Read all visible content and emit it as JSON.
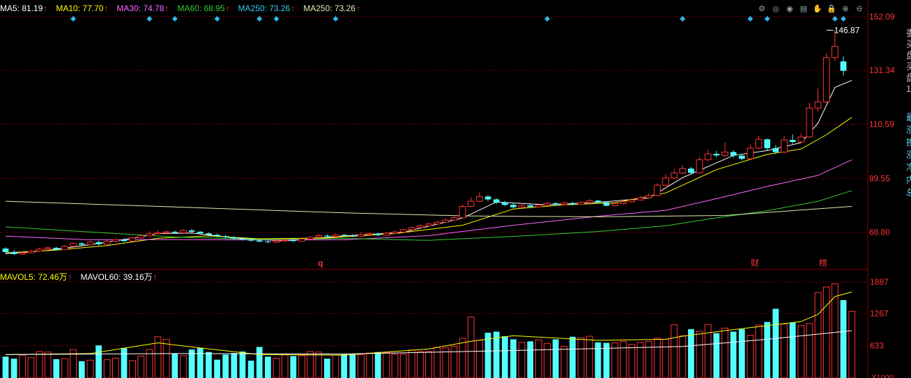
{
  "legend_main": [
    {
      "label": "MA5: 81.19",
      "color": "#ffffff"
    },
    {
      "label": "MA10: 77.70",
      "color": "#ffff00"
    },
    {
      "label": "MA30: 74.78",
      "color": "#ff66ff"
    },
    {
      "label": "MA60: 68.95",
      "color": "#33cc33"
    },
    {
      "label": "MA250: 73.26",
      "color": "#33ccee"
    },
    {
      "label": "MA250: 73.26",
      "color": "#e8e8b0"
    }
  ],
  "legend_volume": [
    {
      "label": "MAVOL5: 72.46万",
      "color": "#ffff00"
    },
    {
      "label": "MAVOL60: 39.16万",
      "color": "#ffffff"
    }
  ],
  "toolbar_icons": [
    "settings-icon",
    "eye-icon",
    "eye-open-icon",
    "calendar-icon",
    "hand-icon",
    "lock-icon",
    "zoom-in-icon",
    "zoom-out-icon"
  ],
  "price_axis_labels": [
    "152.09",
    "131.34",
    "110.59",
    "89.55",
    "68.80"
  ],
  "volume_axis_labels": [
    "1887",
    "1267",
    "633",
    "X1000"
  ],
  "high_label": "146.87",
  "markers": {
    "q": "q",
    "cai": "财",
    "bang": "榜"
  },
  "side_labels": {
    "text": [
      "委",
      "买",
      "盘",
      "买",
      "盘",
      "1"
    ],
    "blue": [
      "最",
      "涨",
      "换",
      "涨",
      "净",
      "内",
      "总"
    ]
  },
  "colors": {
    "up": "#ff3333",
    "down": "#54ffff",
    "grid": "#8b0000",
    "axis_text": "#ff3333",
    "diamond": "#2fb6e9"
  },
  "chart_data": [
    {
      "type": "candlestick",
      "y_axis": {
        "min": 55.0,
        "max": 152.09,
        "ticks": [
          152.09,
          131.34,
          110.59,
          89.55,
          68.8
        ]
      },
      "x_index_range": [
        0,
        100
      ],
      "high_marker": {
        "index": 97,
        "value": 146.87
      },
      "candles": [
        [
          62.5,
          61.2,
          63.0,
          60.8
        ],
        [
          61.2,
          60.4,
          61.9,
          60.0
        ],
        [
          60.4,
          60.9,
          61.4,
          60.1
        ],
        [
          60.9,
          61.5,
          62.0,
          60.6
        ],
        [
          61.5,
          62.3,
          62.9,
          61.2
        ],
        [
          62.3,
          62.8,
          63.3,
          62.0
        ],
        [
          62.8,
          62.1,
          63.2,
          61.7
        ],
        [
          62.1,
          63.4,
          63.8,
          61.9
        ],
        [
          63.4,
          64.5,
          65.0,
          63.1
        ],
        [
          64.5,
          64.0,
          64.9,
          63.6
        ],
        [
          64.0,
          65.0,
          65.5,
          63.8
        ],
        [
          65.0,
          64.2,
          65.5,
          63.7
        ],
        [
          64.2,
          65.3,
          65.8,
          63.9
        ],
        [
          65.3,
          66.0,
          66.4,
          64.9
        ],
        [
          66.0,
          65.4,
          66.5,
          65.0
        ],
        [
          65.4,
          66.6,
          67.0,
          65.2
        ],
        [
          66.6,
          67.4,
          68.0,
          66.3
        ],
        [
          67.4,
          68.2,
          69.2,
          67.1
        ],
        [
          68.2,
          68.6,
          69.6,
          68.0
        ],
        [
          68.6,
          69.0,
          69.5,
          68.3
        ],
        [
          69.0,
          68.6,
          69.4,
          68.1
        ],
        [
          68.6,
          69.5,
          70.0,
          68.4
        ],
        [
          69.5,
          69.0,
          70.1,
          68.6
        ],
        [
          69.0,
          68.4,
          69.3,
          68.0
        ],
        [
          68.4,
          67.8,
          68.7,
          67.3
        ],
        [
          67.8,
          67.3,
          68.2,
          66.9
        ],
        [
          67.3,
          66.9,
          67.7,
          66.5
        ],
        [
          66.9,
          66.4,
          67.3,
          66.0
        ],
        [
          66.4,
          66.0,
          66.9,
          65.6
        ],
        [
          66.0,
          65.6,
          66.4,
          65.2
        ],
        [
          65.6,
          65.2,
          66.0,
          64.9
        ],
        [
          65.2,
          65.0,
          65.6,
          64.6
        ],
        [
          65.0,
          65.5,
          65.9,
          64.7
        ],
        [
          65.5,
          65.8,
          66.2,
          65.2
        ],
        [
          65.8,
          65.4,
          66.3,
          65.0
        ],
        [
          65.4,
          66.2,
          66.7,
          65.1
        ],
        [
          66.2,
          66.9,
          67.4,
          65.9
        ],
        [
          66.9,
          67.5,
          68.2,
          66.6
        ],
        [
          67.5,
          67.2,
          68.0,
          66.8
        ],
        [
          67.2,
          67.8,
          68.3,
          66.9
        ],
        [
          67.8,
          67.6,
          68.2,
          67.3
        ],
        [
          67.6,
          67.3,
          68.0,
          67.0
        ],
        [
          67.3,
          67.9,
          68.9,
          67.1
        ],
        [
          67.9,
          68.3,
          68.8,
          67.6
        ],
        [
          68.3,
          67.7,
          68.6,
          67.3
        ],
        [
          67.7,
          68.4,
          68.9,
          67.4
        ],
        [
          68.4,
          68.9,
          69.4,
          68.1
        ],
        [
          68.9,
          69.8,
          70.3,
          68.7
        ],
        [
          69.8,
          70.6,
          71.2,
          69.5
        ],
        [
          70.6,
          71.3,
          71.9,
          70.3
        ],
        [
          71.3,
          72.0,
          72.6,
          71.0
        ],
        [
          72.0,
          72.7,
          73.3,
          71.7
        ],
        [
          72.7,
          73.5,
          74.2,
          72.4
        ],
        [
          73.5,
          74.4,
          75.1,
          73.2
        ],
        [
          74.4,
          78.8,
          79.5,
          74.1
        ],
        [
          78.8,
          80.8,
          82.4,
          78.5
        ],
        [
          80.8,
          82.6,
          84.3,
          80.4
        ],
        [
          82.6,
          81.5,
          83.1,
          80.9
        ],
        [
          81.5,
          80.3,
          82.0,
          79.8
        ],
        [
          80.3,
          79.4,
          80.9,
          78.9
        ],
        [
          79.4,
          78.5,
          79.9,
          78.0
        ],
        [
          78.5,
          79.2,
          79.8,
          78.1
        ],
        [
          79.2,
          78.6,
          79.7,
          78.2
        ],
        [
          78.6,
          79.3,
          79.9,
          78.3
        ],
        [
          79.3,
          80.0,
          80.6,
          79.0
        ],
        [
          80.0,
          79.5,
          80.5,
          79.1
        ],
        [
          79.5,
          80.1,
          80.7,
          79.2
        ],
        [
          80.1,
          79.6,
          80.5,
          79.2
        ],
        [
          79.6,
          80.3,
          80.9,
          79.3
        ],
        [
          80.3,
          81.0,
          81.6,
          80.0
        ],
        [
          81.0,
          80.4,
          81.4,
          80.0
        ],
        [
          80.4,
          79.1,
          80.7,
          78.7
        ],
        [
          79.1,
          79.9,
          80.5,
          78.8
        ],
        [
          79.9,
          80.6,
          81.2,
          79.6
        ],
        [
          80.6,
          81.3,
          81.9,
          80.3
        ],
        [
          81.3,
          82.1,
          82.9,
          81.0
        ],
        [
          82.1,
          83.0,
          83.9,
          81.8
        ],
        [
          83.0,
          87.0,
          87.7,
          82.7
        ],
        [
          87.0,
          89.8,
          91.3,
          86.6
        ],
        [
          89.8,
          91.7,
          93.3,
          89.4
        ],
        [
          91.7,
          93.4,
          94.8,
          91.3
        ],
        [
          93.4,
          91.8,
          94.0,
          91.0
        ],
        [
          91.8,
          96.8,
          98.0,
          91.5
        ],
        [
          96.8,
          99.1,
          100.7,
          96.3
        ],
        [
          99.1,
          98.5,
          100.2,
          97.8
        ],
        [
          98.5,
          99.8,
          103.5,
          97.9
        ],
        [
          99.8,
          98.4,
          100.5,
          97.6
        ],
        [
          98.4,
          97.2,
          99.0,
          96.6
        ],
        [
          97.2,
          101.3,
          102.7,
          96.9
        ],
        [
          101.3,
          104.7,
          106.1,
          100.8
        ],
        [
          104.7,
          101.3,
          105.0,
          100.3
        ],
        [
          101.3,
          99.8,
          102.5,
          99.0
        ],
        [
          99.8,
          104.5,
          105.9,
          99.3
        ],
        [
          104.5,
          103.7,
          106.6,
          103.0
        ],
        [
          103.7,
          105.6,
          107.2,
          103.2
        ],
        [
          105.6,
          116.8,
          118.9,
          105.3
        ],
        [
          116.8,
          119.2,
          124.3,
          115.5
        ],
        [
          119.2,
          136.3,
          138.0,
          118.7
        ],
        [
          136.3,
          140.6,
          146.87,
          135.0
        ],
        [
          134.8,
          131.2,
          136.8,
          129.4
        ]
      ],
      "ma_lines": [
        {
          "name": "MA5",
          "color": "#ffffff",
          "points": [
            [
              0,
              60.5
            ],
            [
              5,
              61.8
            ],
            [
              10,
              64.0
            ],
            [
              15,
              66.5
            ],
            [
              18,
              68.3
            ],
            [
              22,
              68.5
            ],
            [
              27,
              66.6
            ],
            [
              33,
              65.4
            ],
            [
              40,
              67.4
            ],
            [
              47,
              68.8
            ],
            [
              54,
              74.3
            ],
            [
              58,
              80.5
            ],
            [
              64,
              79.4
            ],
            [
              70,
              80.4
            ],
            [
              76,
              82.0
            ],
            [
              80,
              89.9
            ],
            [
              86,
              98.5
            ],
            [
              90,
              100.4
            ],
            [
              94,
              103.4
            ],
            [
              96,
              111.0
            ],
            [
              98,
              124.8
            ],
            [
              100,
              127.5
            ]
          ]
        },
        {
          "name": "MA10",
          "color": "#ffff00",
          "points": [
            [
              0,
              60.9
            ],
            [
              6,
              61.9
            ],
            [
              12,
              63.7
            ],
            [
              18,
              66.5
            ],
            [
              24,
              67.4
            ],
            [
              30,
              66.3
            ],
            [
              38,
              66.6
            ],
            [
              46,
              68.3
            ],
            [
              54,
              71.5
            ],
            [
              60,
              77.8
            ],
            [
              66,
              79.4
            ],
            [
              72,
              80.2
            ],
            [
              78,
              84.0
            ],
            [
              84,
              93.0
            ],
            [
              90,
              98.9
            ],
            [
              94,
              101.0
            ],
            [
              97,
              106.5
            ],
            [
              100,
              113.2
            ]
          ]
        },
        {
          "name": "MA30",
          "color": "#ff66ff",
          "points": [
            [
              0,
              67.3
            ],
            [
              10,
              65.9
            ],
            [
              20,
              66.0
            ],
            [
              30,
              65.8
            ],
            [
              40,
              65.9
            ],
            [
              50,
              67.5
            ],
            [
              60,
              71.5
            ],
            [
              70,
              75.0
            ],
            [
              78,
              77.3
            ],
            [
              84,
              81.8
            ],
            [
              90,
              86.5
            ],
            [
              96,
              90.8
            ],
            [
              100,
              96.8
            ]
          ]
        },
        {
          "name": "MA60",
          "color": "#33cc33",
          "points": [
            [
              0,
              70.9
            ],
            [
              10,
              68.9
            ],
            [
              20,
              67.0
            ],
            [
              30,
              66.0
            ],
            [
              40,
              66.4
            ],
            [
              50,
              65.7
            ],
            [
              60,
              67.2
            ],
            [
              70,
              69.1
            ],
            [
              78,
              71.3
            ],
            [
              84,
              74.4
            ],
            [
              90,
              77.1
            ],
            [
              96,
              80.8
            ],
            [
              100,
              84.9
            ]
          ]
        },
        {
          "name": "MA250",
          "color": "#e8e8b0",
          "points": [
            [
              0,
              80.8
            ],
            [
              20,
              78.6
            ],
            [
              40,
              76.3
            ],
            [
              55,
              75.1
            ],
            [
              70,
              74.8
            ],
            [
              85,
              75.3
            ],
            [
              100,
              78.8
            ]
          ]
        }
      ],
      "diamond_markers": [
        8,
        17,
        20,
        25,
        30,
        32,
        39,
        64,
        80,
        88,
        90,
        98,
        99
      ]
    },
    {
      "type": "bar",
      "y_axis": {
        "min": 0,
        "max": 1887,
        "ticks": [
          1887,
          1267,
          633
        ]
      },
      "unit_label": "X1000",
      "volumes": [
        420,
        380,
        450,
        400,
        520,
        510,
        370,
        380,
        560,
        330,
        350,
        640,
        360,
        390,
        590,
        340,
        430,
        560,
        810,
        760,
        480,
        440,
        560,
        590,
        510,
        360,
        460,
        490,
        520,
        340,
        610,
        420,
        390,
        460,
        430,
        440,
        520,
        510,
        380,
        450,
        470,
        460,
        460,
        490,
        510,
        500,
        470,
        470,
        550,
        520,
        520,
        600,
        590,
        620,
        780,
        1200,
        740,
        890,
        910,
        820,
        760,
        700,
        720,
        750,
        680,
        760,
        620,
        810,
        790,
        820,
        700,
        690,
        690,
        720,
        660,
        700,
        720,
        780,
        760,
        1050,
        830,
        960,
        920,
        1050,
        880,
        980,
        910,
        960,
        840,
        1040,
        1100,
        1360,
        1060,
        1090,
        1030,
        1070,
        1680,
        1790,
        1850,
        1530,
        1310
      ],
      "mavol_lines": [
        {
          "name": "MAVOL5",
          "color": "#ffff00",
          "points": [
            [
              0,
              460
            ],
            [
              10,
              480
            ],
            [
              18,
              690
            ],
            [
              22,
              610
            ],
            [
              30,
              460
            ],
            [
              40,
              450
            ],
            [
              50,
              570
            ],
            [
              55,
              720
            ],
            [
              60,
              830
            ],
            [
              70,
              740
            ],
            [
              78,
              760
            ],
            [
              80,
              820
            ],
            [
              85,
              930
            ],
            [
              90,
              1030
            ],
            [
              94,
              1110
            ],
            [
              96,
              1250
            ],
            [
              98,
              1600
            ],
            [
              100,
              1690
            ]
          ]
        },
        {
          "name": "MAVOL60",
          "color": "#ffffff",
          "points": [
            [
              0,
              460
            ],
            [
              20,
              480
            ],
            [
              40,
              470
            ],
            [
              60,
              540
            ],
            [
              80,
              620
            ],
            [
              90,
              760
            ],
            [
              100,
              930
            ]
          ]
        }
      ]
    }
  ]
}
